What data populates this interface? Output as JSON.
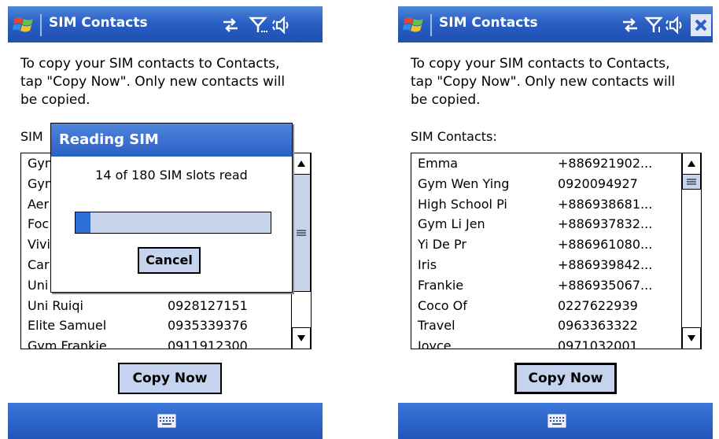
{
  "left_screen": {
    "title": "SIM Contacts",
    "instructions": "To copy your SIM contacts to Contacts, tap \"Copy Now\". Only new contacts will be copied.",
    "list_caption": "SIM",
    "contacts": [
      {
        "name": "Gyn",
        "number": ""
      },
      {
        "name": "Gyn",
        "number": ""
      },
      {
        "name": "Aer",
        "number": ""
      },
      {
        "name": "Foc",
        "number": ""
      },
      {
        "name": "Vivi",
        "number": ""
      },
      {
        "name": "Car",
        "number": ""
      },
      {
        "name": "Uni",
        "number": ""
      },
      {
        "name": "Uni Ruiqi",
        "number": "0928127151"
      },
      {
        "name": "Elite Samuel",
        "number": "0935339376"
      },
      {
        "name": "Gym Frankie",
        "number": "0911912300"
      }
    ],
    "copy_button": "Copy Now",
    "dialog": {
      "title": "Reading SIM",
      "message": "14 of 180 SIM slots read",
      "progress_fraction": 0.078,
      "cancel_label": "Cancel"
    }
  },
  "right_screen": {
    "title": "SIM Contacts",
    "instructions": "To copy your SIM contacts to Contacts, tap \"Copy Now\". Only new contacts will be copied.",
    "list_caption": "SIM Contacts:",
    "contacts": [
      {
        "name": "Emma",
        "number": "+886921902..."
      },
      {
        "name": "Gym Wen Ying",
        "number": "0920094927"
      },
      {
        "name": "High School Pi",
        "number": "+886938681..."
      },
      {
        "name": "Gym Li Jen",
        "number": "+886937832..."
      },
      {
        "name": "Yi De Pr",
        "number": "+886961080..."
      },
      {
        "name": "Iris",
        "number": "+886939842..."
      },
      {
        "name": "Frankie",
        "number": "+886935067..."
      },
      {
        "name": "Coco Of",
        "number": "0227622939"
      },
      {
        "name": "Travel",
        "number": "0963363322"
      },
      {
        "name": "Joyce",
        "number": "0971032001"
      }
    ],
    "copy_button": "Copy Now"
  },
  "icons": {
    "start": "windows-flag-icon",
    "connectivity": "connectivity-arrows-icon",
    "signal": "signal-antenna-icon",
    "volume": "speaker-volume-icon",
    "close": "close-icon",
    "keyboard": "keyboard-icon"
  },
  "colors": {
    "titlebar": "#2a5fc4",
    "button_face": "#c6d3ee",
    "progress_fill": "#2d6fd4"
  }
}
